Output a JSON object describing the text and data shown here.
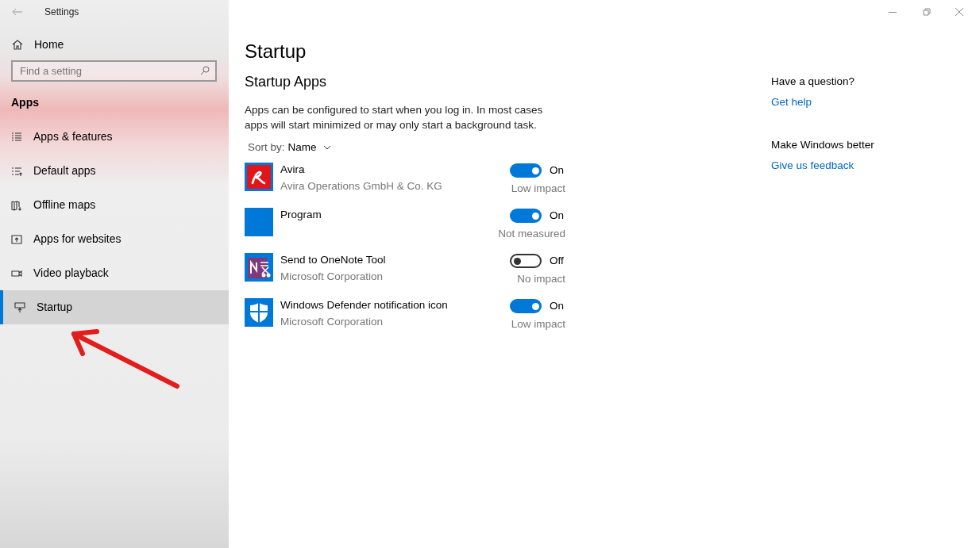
{
  "window": {
    "title": "Settings"
  },
  "sidebar": {
    "home": "Home",
    "search": {
      "placeholder": "Find a setting"
    },
    "section": "Apps",
    "items": [
      {
        "label": "Apps & features",
        "kind": "list",
        "selected": false
      },
      {
        "label": "Default apps",
        "kind": "defaults",
        "selected": false
      },
      {
        "label": "Offline maps",
        "kind": "map",
        "selected": false
      },
      {
        "label": "Apps for websites",
        "kind": "web",
        "selected": false
      },
      {
        "label": "Video playback",
        "kind": "video",
        "selected": false
      },
      {
        "label": "Startup",
        "kind": "startup",
        "selected": true
      }
    ]
  },
  "main": {
    "title": "Startup",
    "subtitle": "Startup Apps",
    "description": "Apps can be configured to start when you log in. In most cases apps will start minimized or may only start a background task.",
    "sort_label": "Sort by:",
    "sort_value": "Name",
    "apps": [
      {
        "name": "Avira",
        "publisher": "Avira Operations GmbH & Co. KG",
        "kind": "avira",
        "on": true,
        "state": "On",
        "impact": "Low impact"
      },
      {
        "name": "Program",
        "kind": "blank",
        "on": true,
        "state": "On",
        "impact": "Not measured"
      },
      {
        "name": "Send to OneNote Tool",
        "publisher": "Microsoft Corporation",
        "kind": "onenote",
        "on": false,
        "state": "Off",
        "impact": "No impact"
      },
      {
        "name": "Windows Defender notification icon",
        "publisher": "Microsoft Corporation",
        "kind": "shield",
        "on": true,
        "state": "On",
        "impact": "Low impact"
      }
    ]
  },
  "help": [
    {
      "heading": "Have a question?",
      "link": "Get help"
    },
    {
      "heading": "Make Windows better",
      "link": "Give us feedback"
    }
  ]
}
